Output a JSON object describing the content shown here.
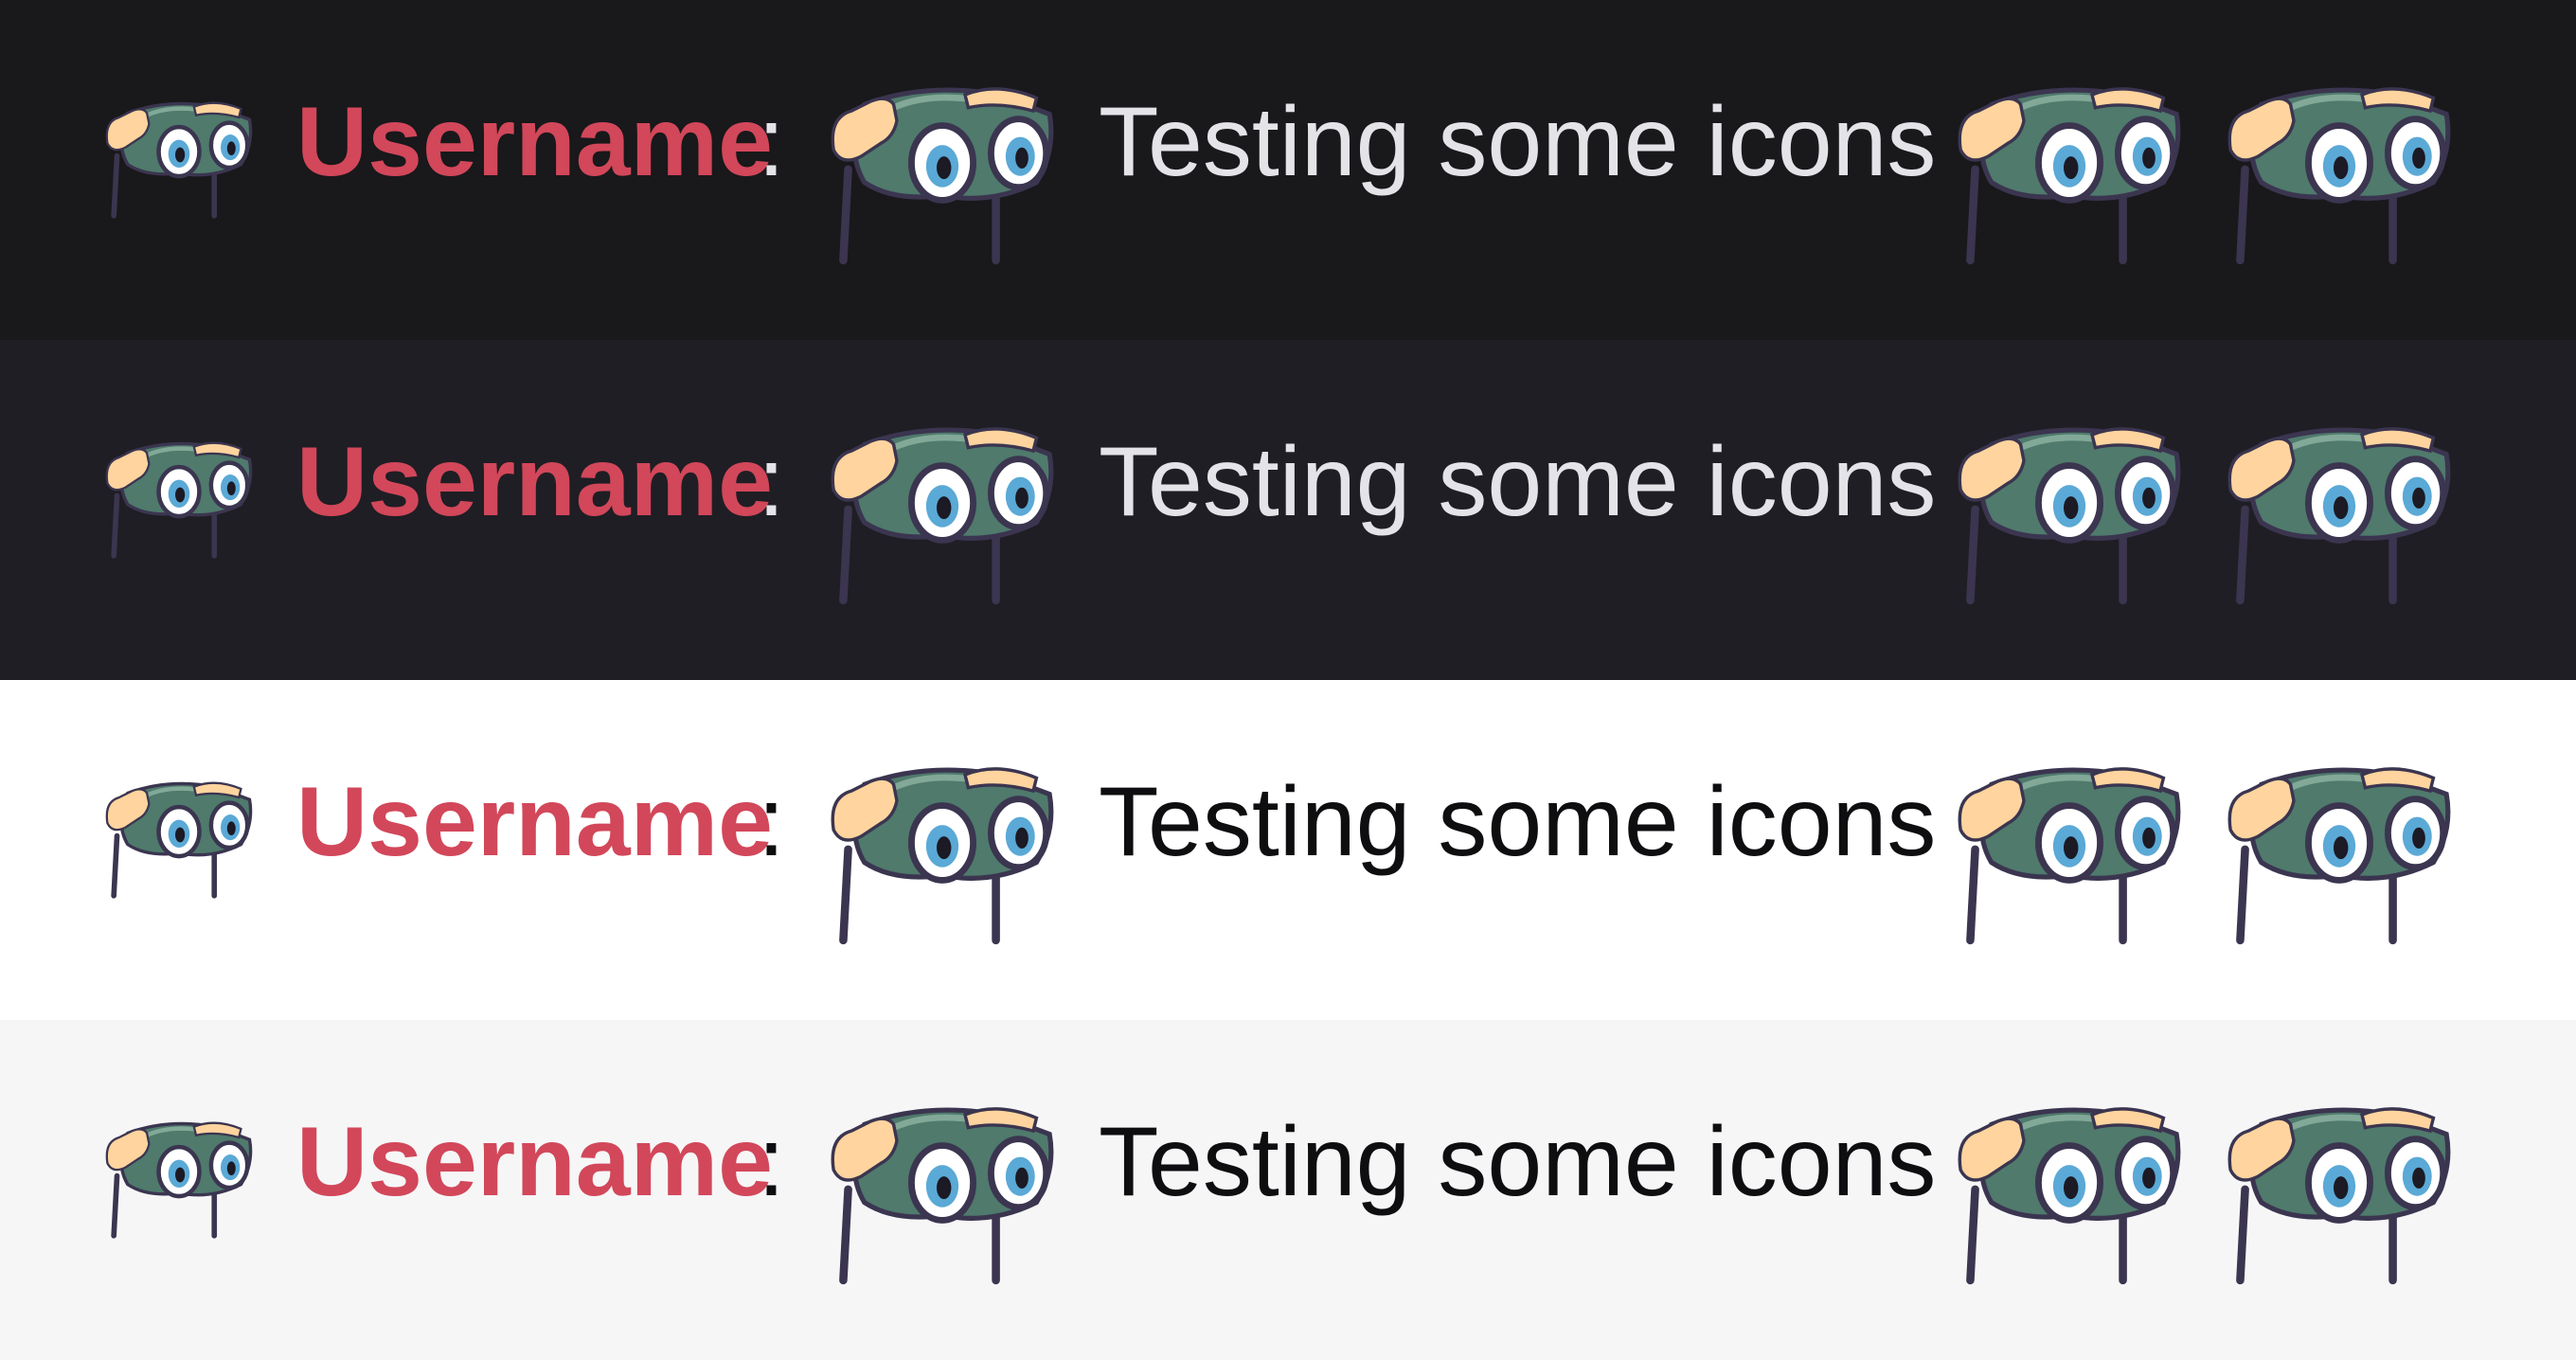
{
  "rows": [
    {
      "theme": "dark",
      "background": "#19181b",
      "text_color": "#e4e4e8",
      "username": "Username",
      "separator": ":",
      "message": "Testing some icons"
    },
    {
      "theme": "dark-alt",
      "background": "#1f1e24",
      "text_color": "#e4e4e8",
      "username": "Username",
      "separator": ":",
      "message": "Testing some icons"
    },
    {
      "theme": "light",
      "background": "#ffffff",
      "text_color": "#0e0e10",
      "username": "Username",
      "separator": ":",
      "message": "Testing some icons"
    },
    {
      "theme": "light-alt",
      "background": "#f6f6f7",
      "text_color": "#0e0e10",
      "username": "Username",
      "separator": ":",
      "message": "Testing some icons"
    }
  ],
  "username_color": "#d2475a",
  "icons": {
    "badge": "binoculars-badge-icon",
    "emote": "binoculars-emote-icon"
  }
}
